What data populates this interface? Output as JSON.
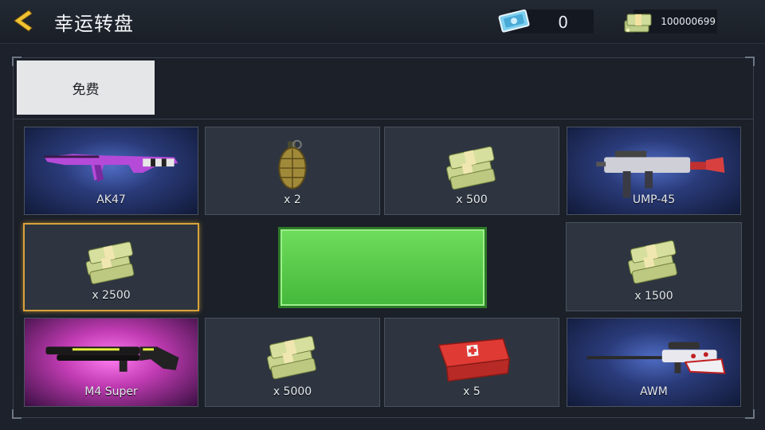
{
  "header": {
    "title": "幸运转盘"
  },
  "currency": {
    "tickets": "0",
    "cash": "100000699"
  },
  "tabs": {
    "free_label": "免费"
  },
  "rewards": [
    {
      "label": "AK47",
      "icon": "ak47-rifle-icon"
    },
    {
      "label": "x 2",
      "icon": "grenade-icon"
    },
    {
      "label": "x 500",
      "icon": "cash-stack-icon"
    },
    {
      "label": "UMP-45",
      "icon": "ump45-smg-icon"
    },
    {
      "label": "x 1500",
      "icon": "cash-stack-icon"
    },
    {
      "label": "AWM",
      "icon": "awm-sniper-icon"
    },
    {
      "label": "x 5",
      "icon": "medkit-icon"
    },
    {
      "label": "x 5000",
      "icon": "cash-stack-icon"
    },
    {
      "label": "M4 Super",
      "icon": "m4-super-shotgun-icon"
    },
    {
      "label": "x 2500",
      "icon": "cash-stack-icon"
    }
  ],
  "colors": {
    "accent_gold": "#f1c232",
    "spin_green": "#5ccc4a",
    "selected_border": "#d9a33a"
  }
}
